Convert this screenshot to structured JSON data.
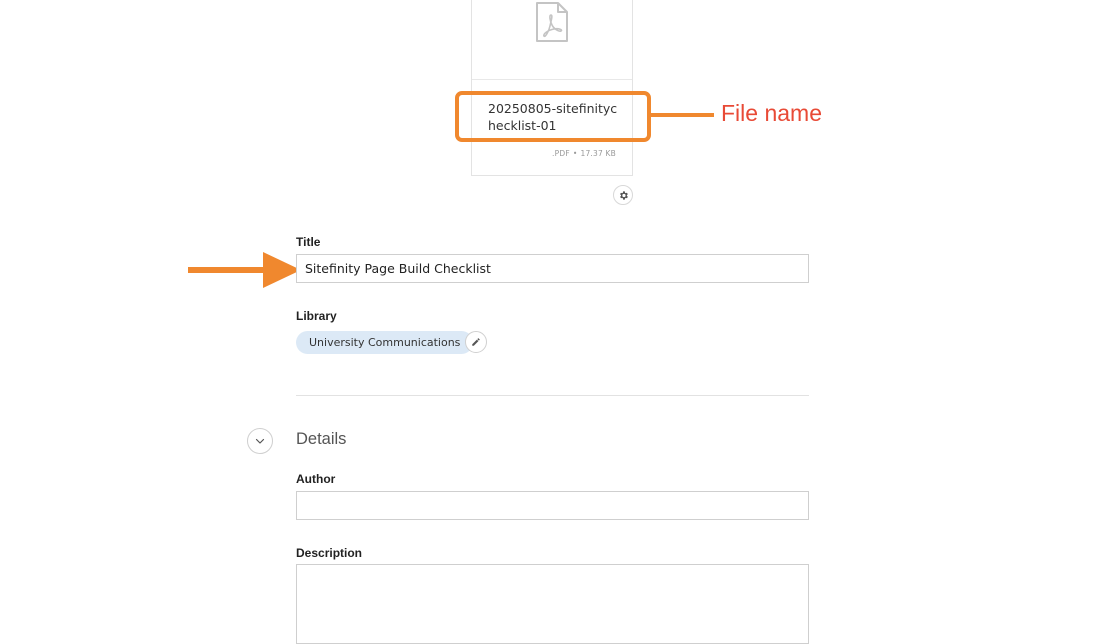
{
  "file": {
    "icon": "pdf-file-icon",
    "name": "20250805-sitefinitychecklist-01",
    "extension": ".PDF",
    "separator": "•",
    "size": "17.37 KB",
    "settings_icon": "gear-icon"
  },
  "annotations": {
    "file_name_label": "File name",
    "color": "#f0882e",
    "label_color": "#e84a36"
  },
  "form": {
    "title": {
      "label": "Title",
      "value": "Sitefinity Page Build Checklist"
    },
    "library": {
      "label": "Library",
      "value": "University Communications",
      "edit_icon": "pencil-icon"
    },
    "details": {
      "heading": "Details",
      "toggle_icon": "chevron-down-icon",
      "author": {
        "label": "Author",
        "value": ""
      },
      "description": {
        "label": "Description",
        "value": ""
      }
    }
  },
  "colors": {
    "chip_background": "#dce9f6",
    "border": "#cfcfcf"
  }
}
